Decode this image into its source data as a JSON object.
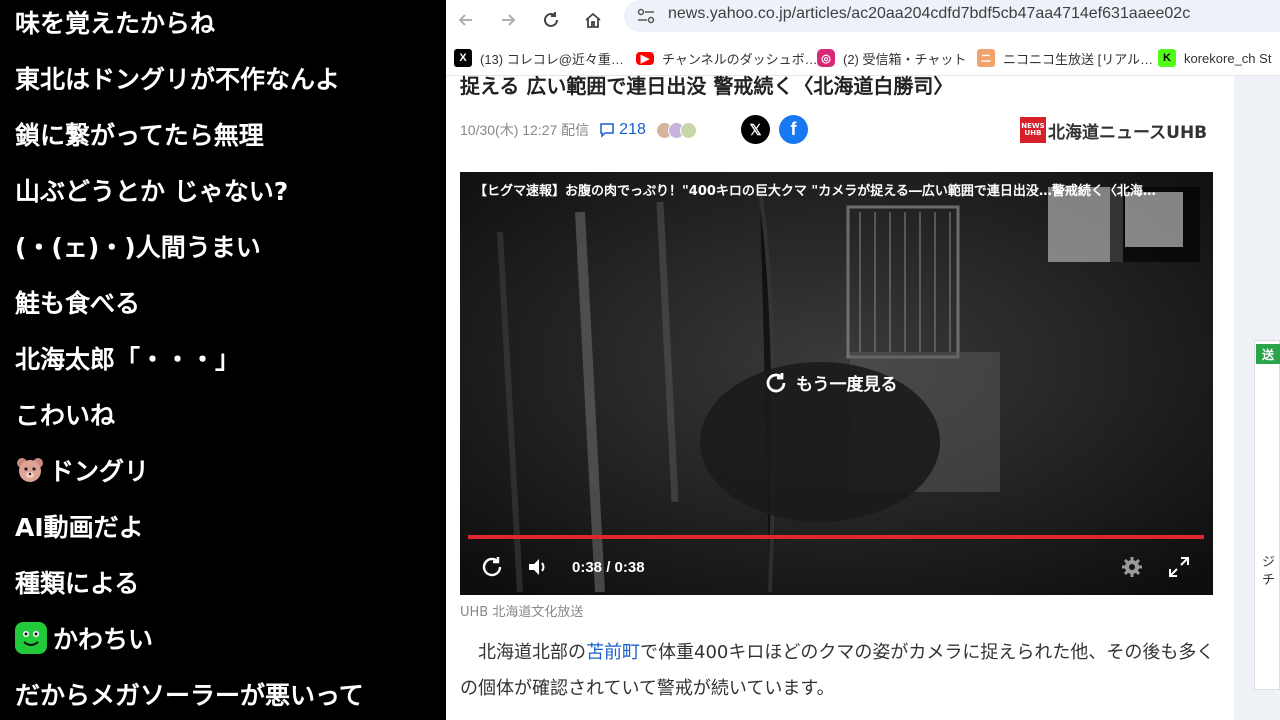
{
  "comments": [
    {
      "text": "味を覚えたからね"
    },
    {
      "text": "東北はドングリが不作なんよ"
    },
    {
      "text": "鎖に繋がってたら無理"
    },
    {
      "text": "山ぶどうとか じゃない?"
    },
    {
      "text": "(・(ェ)・)人間うまい"
    },
    {
      "text": "鮭も食べる"
    },
    {
      "text": "北海太郎「・・・」"
    },
    {
      "text": "こわいね"
    },
    {
      "text": "ドングリ",
      "icon": "bear-face-icon"
    },
    {
      "text": "AI動画だよ"
    },
    {
      "text": "種類による"
    },
    {
      "text": "かわちい",
      "icon": "green-face-icon"
    },
    {
      "text": "だからメガソーラーが悪いって"
    }
  ],
  "browser": {
    "url": "news.yahoo.co.jp/articles/ac20aa204cdfd7bdf5cb47aa4714ef631aaee02c",
    "bookmarks": [
      {
        "label": "(13) コレコレ@近々重…",
        "icon": "x-icon",
        "color": "#000000"
      },
      {
        "label": "チャンネルのダッシュボ…",
        "icon": "youtube-icon",
        "color": "#ff0000"
      },
      {
        "label": "(2) 受信箱・チャット",
        "icon": "instagram-icon",
        "color": "#d62976"
      },
      {
        "label": "ニコニコ生放送 [リアル…",
        "icon": "niconico-icon",
        "color": "#f2a36b"
      },
      {
        "label": "korekore_ch St",
        "icon": "kick-icon",
        "color": "#53fc18"
      }
    ]
  },
  "article": {
    "headline": "捉える 広い範囲で連日出没 警戒続く〈北海道白勝司〉",
    "date": "10/30(木) 12:27 配信",
    "comment_count": "218",
    "publisher": "北海道ニュースUHB",
    "publisher_logo_text": "NEWS UHB",
    "video": {
      "title": "【ヒグマ速報】お腹の肉でっぷり！\"400キロの巨大クマ \"カメラが捉える―広い範囲で連日出没…警戒続く〈北海…",
      "replay_label": "もう一度見る",
      "time": "0:38 / 0:38",
      "progress": 1.0
    },
    "caption": "UHB 北海道文化放送",
    "body_pre": "北海道北部の",
    "body_link": "苫前町",
    "body_post": "で体重400キロほどのクマの姿がカメラに捉えられた他、その後も多くの個体が確認されていて警戒が続いています。"
  },
  "sidebar": {
    "badge": "送",
    "snippet": "ジチ"
  }
}
